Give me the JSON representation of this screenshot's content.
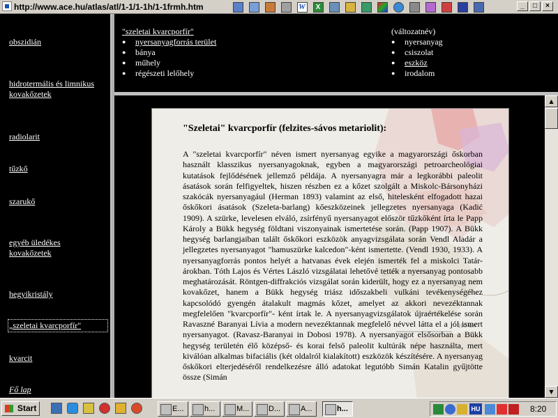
{
  "window": {
    "url": "http://www.ace.hu/atlas/atl/1-1/1-1h/1-1frmh.htm",
    "toolbar_icons": [
      "notepad-icon",
      "copy-icon",
      "paint-icon",
      "clipboard-icon",
      "word-icon",
      "excel-icon",
      "media-icon",
      "key-icon",
      "chart-icon",
      "paint-brush-icon",
      "globe-icon",
      "calc-icon",
      "cube-icon",
      "pen-icon",
      "save-icon",
      "window-icon"
    ],
    "controls": {
      "minimize": "_",
      "maximize": "□",
      "close": "×"
    }
  },
  "left_nav": {
    "items": [
      {
        "label": "obszidián"
      },
      {
        "label": "hidrotermális és limnikus kovakőzetek"
      },
      {
        "label": "radiolarit"
      },
      {
        "label": "tűzkő"
      },
      {
        "label": "szarukő"
      },
      {
        "label": "egyéb üledékes kovakőzetek"
      },
      {
        "label": "hegyikristály"
      },
      {
        "label": "„szeletai kvarcporfír\""
      },
      {
        "label": "kvarcit"
      },
      {
        "label": "Fő lap"
      }
    ]
  },
  "top_frame": {
    "left_heading": "\"szeletai kvarcporfír\"",
    "left_items": [
      {
        "label": "nyersanyagforrás terület"
      },
      {
        "label": "bánya"
      },
      {
        "label": "műhely"
      },
      {
        "label": "régészeti lelőhely"
      }
    ],
    "right_heading": "(változatnév)",
    "right_items": [
      {
        "label": "nyersanyag"
      },
      {
        "label": "csiszolat"
      },
      {
        "label": "eszköz"
      },
      {
        "label": "irodalom"
      }
    ]
  },
  "article": {
    "title": "\"Szeletai\" kvarcporfír (felzites-sávos metariolit):",
    "body": "A \"szeletai kvarcporfír\" néven ismert nyersanyag egyike a magyarországi őskorban használt klasszikus nyersanyagoknak, egyben a magyarországi petroarcheológiai kutatások fejlődésének jellemző példája. A nyersanyagra már a legkorábbi paleolit ásatások során felfigyeltek, hiszen részben ez a kőzet szolgált a Miskolc-Bársonyházi szakócák nyersanyagául (Herman 1893) valamint az első, hitelesként elfogadott hazai őskőkori ásatások (Szeleta-barlang) kőeszközeinek jellegzetes nyersanyaga (Kadić 1909). A szürke, levelesen elváló, zsírfényű nyersanyagot először tűzkőként írta le Papp Károly a Bükk hegység földtani viszonyainak ismertetése során. (Papp 1907). A Bükk hegység barlangjaiban talált őskőkori eszközök anyagvizsgálata során Vendl Aladár a jellegzetes nyersanyagot \"hamuszürke kalcedon\"-ként ismertette. (Vendl 1930, 1933). A nyersanyagforrás pontos helyét a hatvanas évek elején ismerték fel a miskolci Tatár-árokban. Tóth Lajos és Vértes László vizsgálatai lehetővé tették a nyersanyag pontosabb meghatározását. Röntgen-diffrakciós vizsgálat során kiderült, hogy ez a nyersanyag nem kovakőzet, hanem a Bükk hegység triász időszakbeli vulkáni tevékenységéhez kapcsolódó gyengén átalakult magmás kőzet, amelyet az akkori nevezéktannak megfelelően \"kvarcporfír\"- ként írtak le. A nyersanyagvizsgálatok újraértékelése során Ravaszné Baranyai Lívia a modern nevezéktannak megfelelő névvel látta el a jól ismert nyersanyagot. (Ravasz-Baranyai in Dobosi 1978). A nyersanyagot elsősorban a Bükk hegység területén élő középső- és korai felső paleolit kultúrák népe használta, mert kiválóan alkalmas bifaciális (két oldalról kialakított) eszközök készítésére. A nyersanyag őskőkori elterjedéséről rendelkezésre álló adatokat legutóbb Simán Katalin gyűjtötte össze (Simán",
    "map_scale_label": "100 km"
  },
  "taskbar": {
    "start_label": "Start",
    "quicklaunch": [
      "desktop-icon",
      "ie-icon",
      "outlook-icon",
      "opera-icon",
      "winamp-icon",
      "media-player-icon"
    ],
    "tasks": [
      {
        "label": "E..."
      },
      {
        "label": "h..."
      },
      {
        "label": "M..."
      },
      {
        "label": "D..."
      },
      {
        "label": "A..."
      },
      {
        "label": "h..."
      }
    ],
    "language": "HU",
    "clock": "8:20"
  },
  "colors": {
    "background": "#000000",
    "chrome": "#d4d0c8",
    "paper": "#efede7",
    "link": "#ffffff"
  }
}
